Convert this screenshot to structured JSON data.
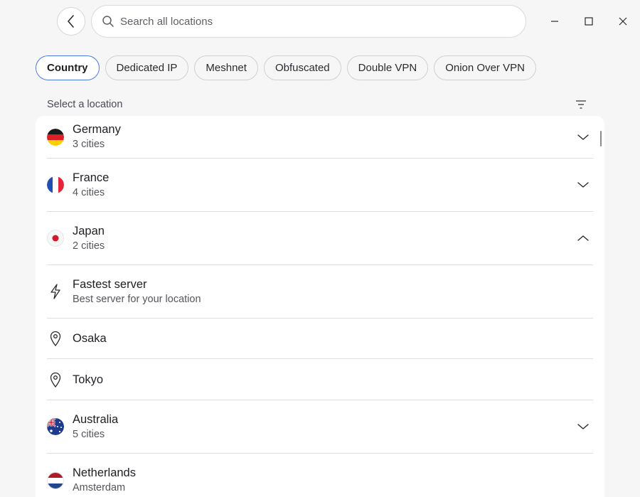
{
  "search": {
    "placeholder": "Search all locations"
  },
  "tabs": [
    {
      "label": "Country",
      "active": true
    },
    {
      "label": "Dedicated IP"
    },
    {
      "label": "Meshnet"
    },
    {
      "label": "Obfuscated"
    },
    {
      "label": "Double VPN"
    },
    {
      "label": "Onion Over VPN"
    }
  ],
  "section_label": "Select a location",
  "locations": [
    {
      "name": "Germany",
      "sub": "3 cities",
      "icon": "germany-flag",
      "state": "collapsed"
    },
    {
      "name": "France",
      "sub": "4 cities",
      "icon": "france-flag",
      "state": "collapsed"
    },
    {
      "name": "Japan",
      "sub": "2 cities",
      "icon": "japan-flag",
      "state": "expanded"
    },
    {
      "name": "Fastest server",
      "sub": "Best server for your location",
      "icon": "lightning-icon"
    },
    {
      "name": "Osaka",
      "icon": "location-pin-icon"
    },
    {
      "name": "Tokyo",
      "icon": "location-pin-icon"
    },
    {
      "name": "Australia",
      "sub": "5 cities",
      "icon": "australia-flag",
      "state": "collapsed"
    },
    {
      "name": "Netherlands",
      "sub": "Amsterdam",
      "icon": "netherlands-flag"
    }
  ],
  "colors": {
    "accent": "#4a7ce0",
    "background": "#f6f6f7",
    "panel": "#ffffff"
  }
}
